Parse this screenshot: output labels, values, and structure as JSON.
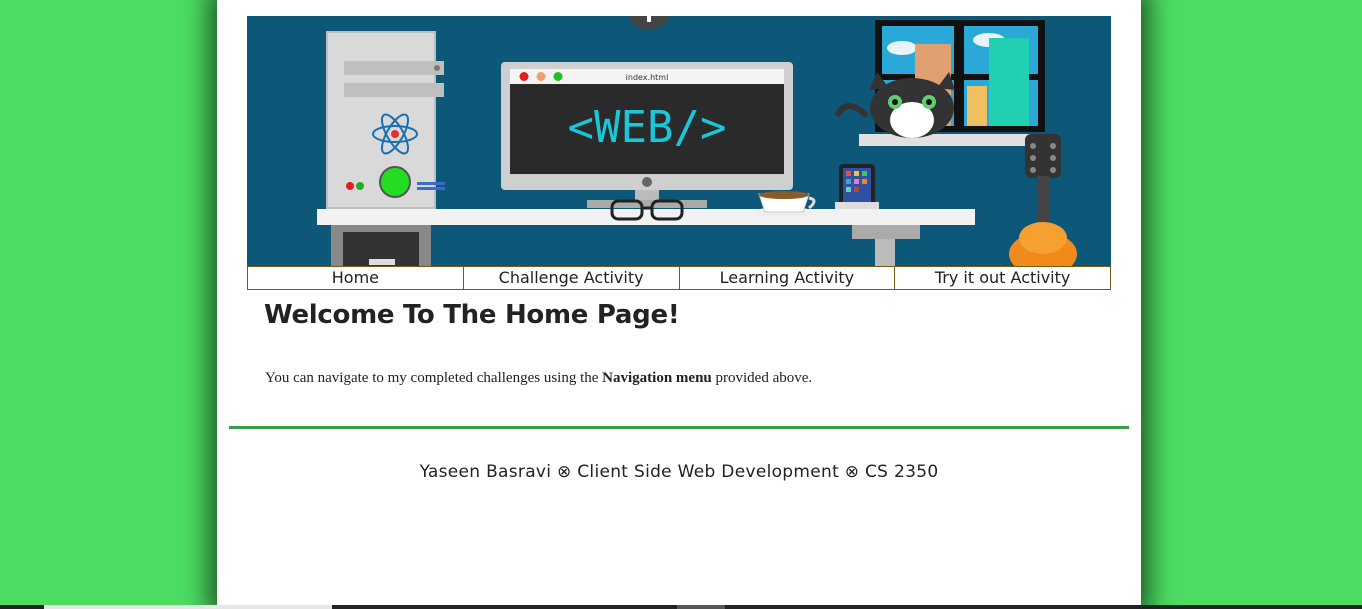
{
  "banner": {
    "monitor_tab_title": "index.html",
    "monitor_text": "<WEB/>"
  },
  "nav": {
    "items": [
      {
        "label": "Home"
      },
      {
        "label": "Challenge Activity"
      },
      {
        "label": "Learning Activity"
      },
      {
        "label": "Try it out Activity"
      }
    ]
  },
  "main": {
    "heading": "Welcome To The Home Page!",
    "intro_before": "You can navigate to my completed challenges using the ",
    "intro_bold": "Navigation menu",
    "intro_after": " provided above."
  },
  "footer": {
    "text": "Yaseen Basravi ⊗ Client Side Web Development ⊗ CS 2350"
  },
  "colors": {
    "page_background": "#4cdc62",
    "banner_background": "#0d5878",
    "divider": "#3a9a48",
    "nav_border": "#7a5a12"
  }
}
